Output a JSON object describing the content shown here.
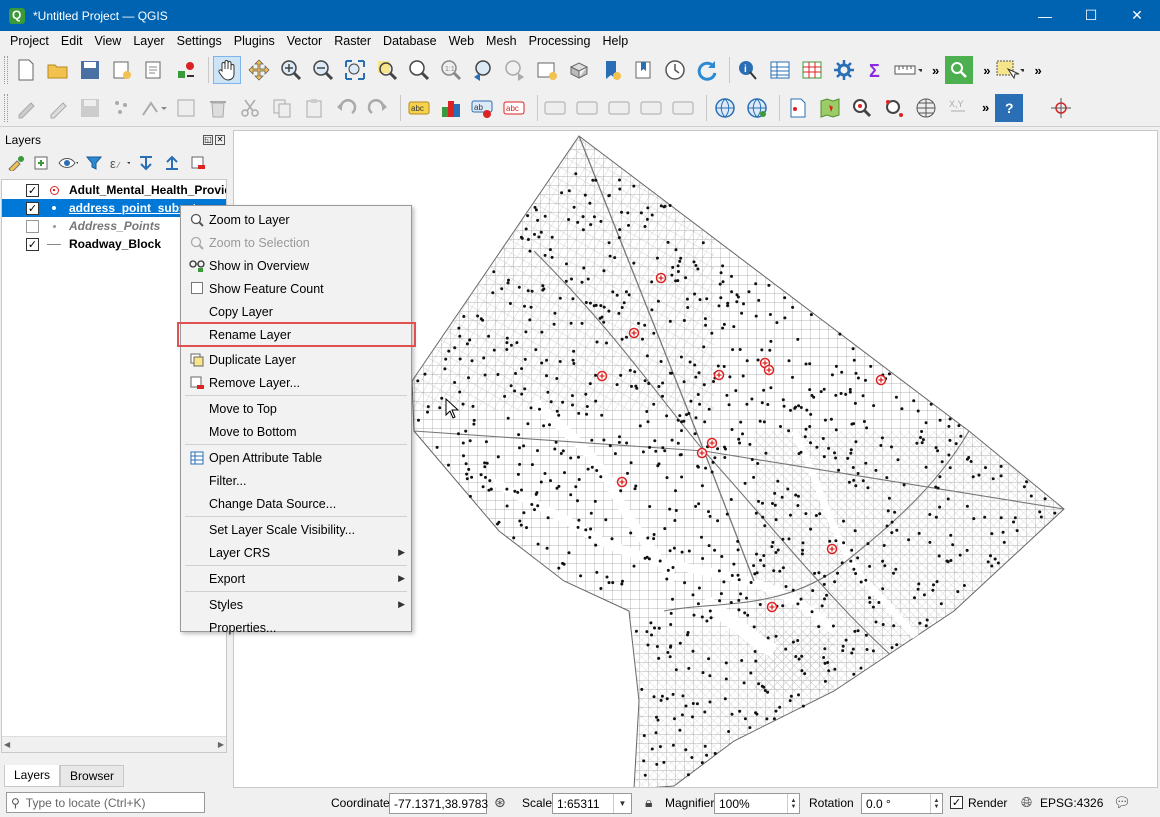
{
  "window": {
    "title": "*Untitled Project — QGIS",
    "minimize": "—",
    "maximize": "☐",
    "close": "✕"
  },
  "menubar": [
    "Project",
    "Edit",
    "View",
    "Layer",
    "Settings",
    "Plugins",
    "Vector",
    "Raster",
    "Database",
    "Web",
    "Mesh",
    "Processing",
    "Help"
  ],
  "toolbar1_more": "»",
  "layers_panel": {
    "title": "Layers",
    "layers": [
      {
        "name": "Adult_Mental_Health_Provid",
        "checked": "✓",
        "symbol": "red-circle"
      },
      {
        "name": "address_point_subset",
        "checked": "✓",
        "symbol": "dot",
        "selected": true
      },
      {
        "name": "Address_Points",
        "checked": "",
        "symbol": "grey-dot"
      },
      {
        "name": "Roadway_Block",
        "checked": "✓",
        "symbol": "line"
      }
    ],
    "tabs": [
      "Layers",
      "Browser"
    ]
  },
  "context_menu": {
    "items": [
      {
        "label": "Zoom to Layer",
        "icon": "zoom-layer-icon"
      },
      {
        "label": "Zoom to Selection",
        "icon": "zoom-selection-icon",
        "disabled": true
      },
      {
        "label": "Show in Overview",
        "icon": "overview-icon"
      },
      {
        "label": "Show Feature Count",
        "icon": "checkbox"
      },
      {
        "label": "Copy Layer"
      },
      {
        "label": "Rename Layer",
        "highlight": true
      },
      {
        "label": "Duplicate Layer",
        "icon": "duplicate-icon"
      },
      {
        "label": "Remove Layer...",
        "icon": "remove-icon"
      },
      {
        "label": "Move to Top"
      },
      {
        "label": "Move to Bottom"
      },
      {
        "label": "Open Attribute Table",
        "icon": "table-icon"
      },
      {
        "label": "Filter..."
      },
      {
        "label": "Change Data Source..."
      },
      {
        "label": "Set Layer Scale Visibility..."
      },
      {
        "label": "Layer CRS",
        "submenu": true
      },
      {
        "label": "Export",
        "submenu": true
      },
      {
        "label": "Styles",
        "submenu": true
      },
      {
        "label": "Properties..."
      }
    ]
  },
  "statusbar": {
    "locate_placeholder": "Type to locate (Ctrl+K)",
    "coordinate_label": "Coordinate",
    "coordinate_value": "-77.1371,38.9783",
    "scale_label": "Scale",
    "scale_value": "1:65311",
    "magnifier_label": "Magnifier",
    "magnifier_value": "100%",
    "rotation_label": "Rotation",
    "rotation_value": "0.0 °",
    "render_label": "Render",
    "render_checked": "✓",
    "crs": "EPSG:4326"
  },
  "colors": {
    "titlebar": "#0063b1",
    "selection": "#0078d7",
    "marker": "#d22222",
    "highlight_box": "#e15050"
  }
}
